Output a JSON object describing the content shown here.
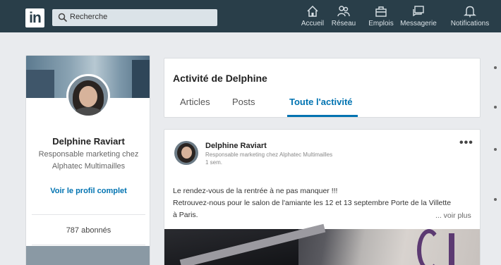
{
  "topbar": {
    "logo": "in",
    "search_placeholder": "Recherche",
    "nav": [
      {
        "label": "Accueil",
        "icon": "home-icon"
      },
      {
        "label": "Réseau",
        "icon": "network-icon"
      },
      {
        "label": "Emplois",
        "icon": "jobs-icon"
      },
      {
        "label": "Messagerie",
        "icon": "messaging-icon"
      },
      {
        "label": "Notifications",
        "icon": "bell-icon"
      }
    ]
  },
  "profile": {
    "name": "Delphine Raviart",
    "title": "Responsable marketing chez Alphatec Multimailles",
    "view_profile": "Voir le profil complet",
    "followers": "787 abonnés"
  },
  "activity": {
    "title": "Activité de Delphine",
    "tabs": [
      "Articles",
      "Posts",
      "Toute l'activité"
    ],
    "active_tab": "Toute l'activité"
  },
  "post": {
    "author": "Delphine Raviart",
    "subtitle": "Responsable marketing chez Alphatec Multimailles",
    "time": "1 sem.",
    "more": "•••",
    "text_lines": [
      "Le rendez-vous de la rentrée à ne pas manquer !!!",
      "Retrouvez-nous pour le salon de l'amiante les 12 et 13 septembre Porte de la Villette",
      "à Paris."
    ],
    "see_more": "... voir plus"
  },
  "colors": {
    "topbar": "#293e49",
    "accent": "#0073b1",
    "background": "#e9ebee"
  }
}
